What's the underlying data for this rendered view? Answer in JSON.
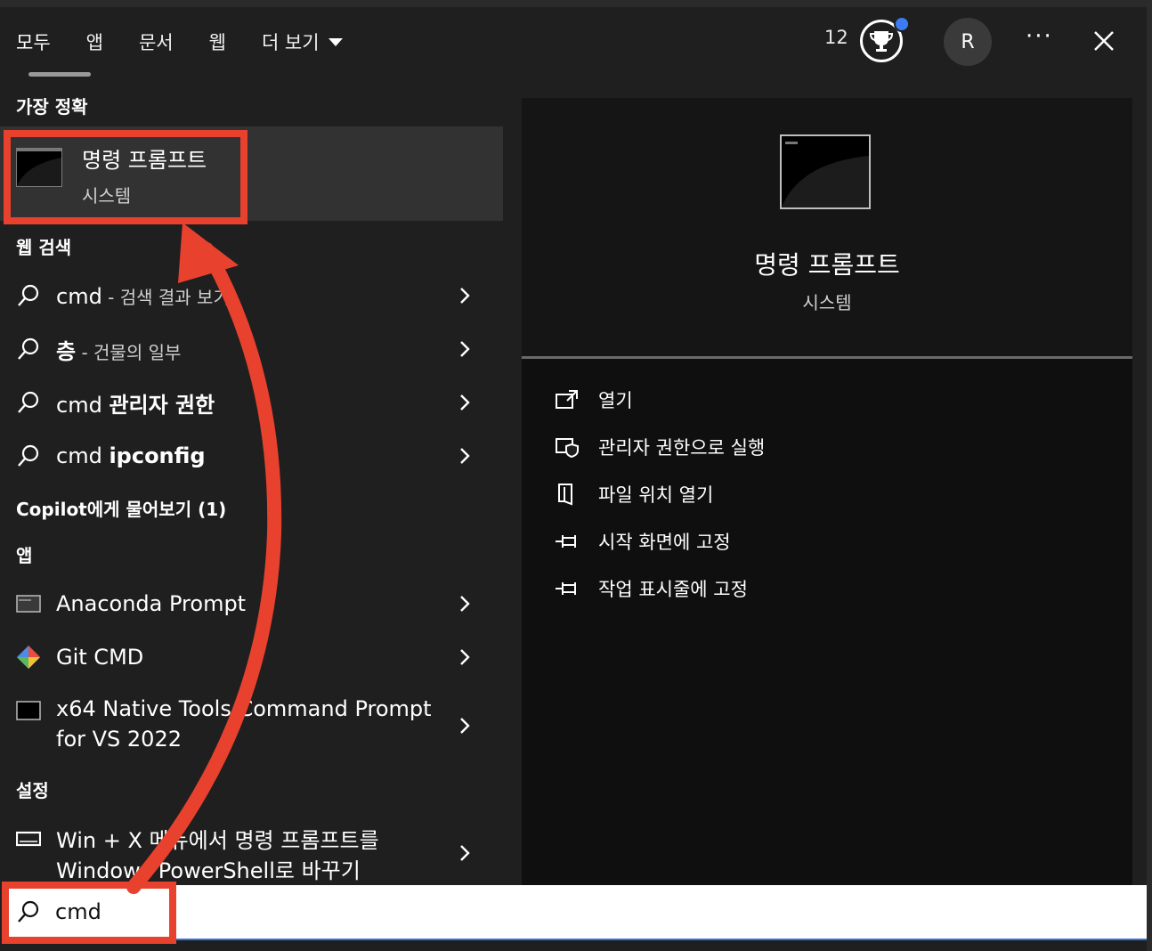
{
  "tabs": {
    "all": "모두",
    "apps": "앱",
    "documents": "문서",
    "web": "웹",
    "more": "더 보기"
  },
  "header": {
    "points": "12",
    "avatar_initial": "R",
    "more_label": "···"
  },
  "sections": {
    "best_match": "가장 정확",
    "web_search": "웹 검색",
    "copilot": "Copilot에게 물어보기 (1)",
    "apps": "앱",
    "settings": "설정"
  },
  "best_match": {
    "title": "명령 프롬프트",
    "subtitle": "시스템"
  },
  "web_results": [
    {
      "query": "cmd",
      "suffix": " - 검색 결과 보기"
    },
    {
      "query": "층",
      "suffix": " - 건물의 일부"
    },
    {
      "prefix": "cmd ",
      "bold": "관리자 권한"
    },
    {
      "prefix": "cmd ",
      "bold": "ipconfig"
    }
  ],
  "apps": [
    {
      "name": "Anaconda Prompt"
    },
    {
      "name": "Git CMD"
    },
    {
      "line1": "x64 Native Tools Command Prompt",
      "line2": "for VS 2022"
    }
  ],
  "settings_items": [
    {
      "line1": "Win + X 메뉴에서 명령 프롬프트를",
      "line2": "Windows PowerShell로 바꾸기"
    }
  ],
  "detail": {
    "title": "명령 프롬프트",
    "subtitle": "시스템",
    "actions": [
      "열기",
      "관리자 권한으로 실행",
      "파일 위치 열기",
      "시작 화면에 고정",
      "작업 표시줄에 고정"
    ]
  },
  "search": {
    "value": "cmd"
  },
  "colors": {
    "annotation_red": "#e8412e",
    "panel_bg": "#1f1f1f",
    "selected_bg": "#323232",
    "accent_blue": "#3d7bf2"
  }
}
